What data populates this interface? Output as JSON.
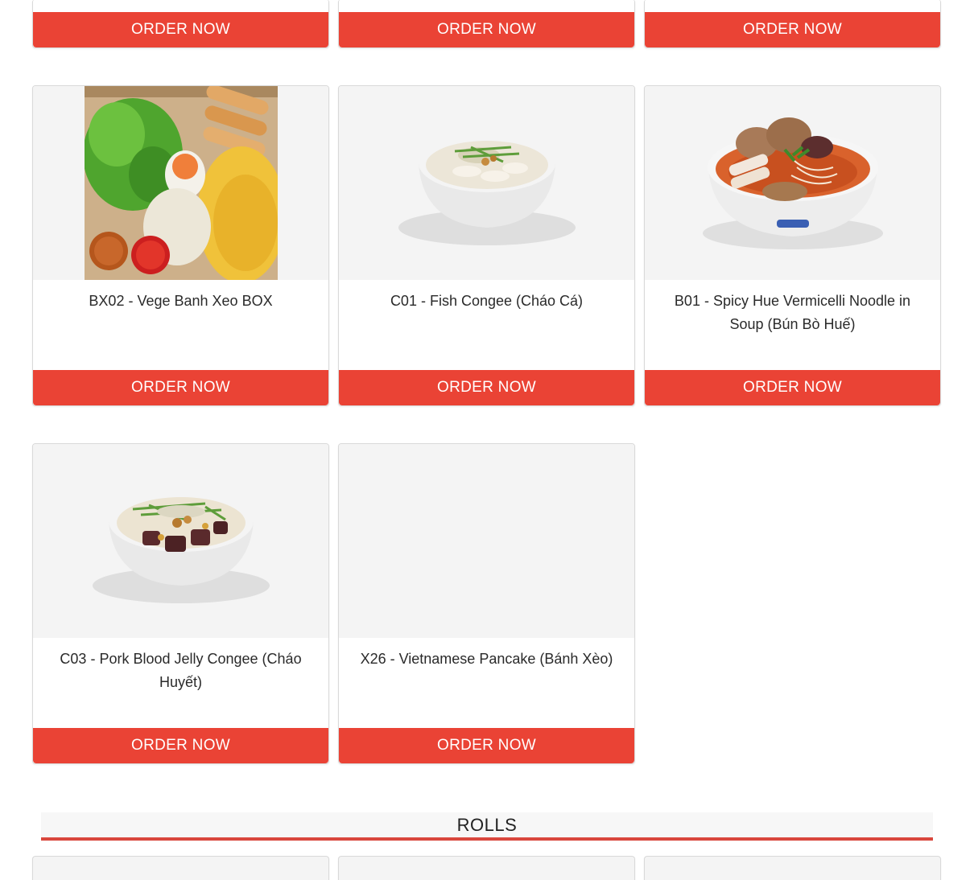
{
  "top_row": {
    "cards": [
      {
        "button": "ORDER NOW"
      },
      {
        "button": "ORDER NOW"
      },
      {
        "button": "ORDER NOW"
      }
    ]
  },
  "menu_items": [
    {
      "title": "BX02 - Vege Banh Xeo BOX",
      "button": "ORDER NOW",
      "image": "vege-banh-xeo-box-photo"
    },
    {
      "title": "C01 - Fish Congee (Cháo Cá)",
      "button": "ORDER NOW",
      "image": "fish-congee-photo"
    },
    {
      "title": "B01 - Spicy Hue Vermicelli Noodle in Soup (Bún Bò Huế)",
      "button": "ORDER NOW",
      "image": "bun-bo-hue-photo"
    },
    {
      "title": "C03 - Pork Blood Jelly Congee (Cháo Huyết)",
      "button": "ORDER NOW",
      "image": "pork-blood-congee-photo"
    },
    {
      "title": "X26 - Vietnamese Pancake (Bánh Xèo)",
      "button": "ORDER NOW",
      "image": "placeholder"
    }
  ],
  "section": {
    "title": "ROLLS"
  },
  "colors": {
    "accent": "#ea4335",
    "card_image_bg": "#f4f4f4",
    "section_underline": "#d9473d"
  }
}
